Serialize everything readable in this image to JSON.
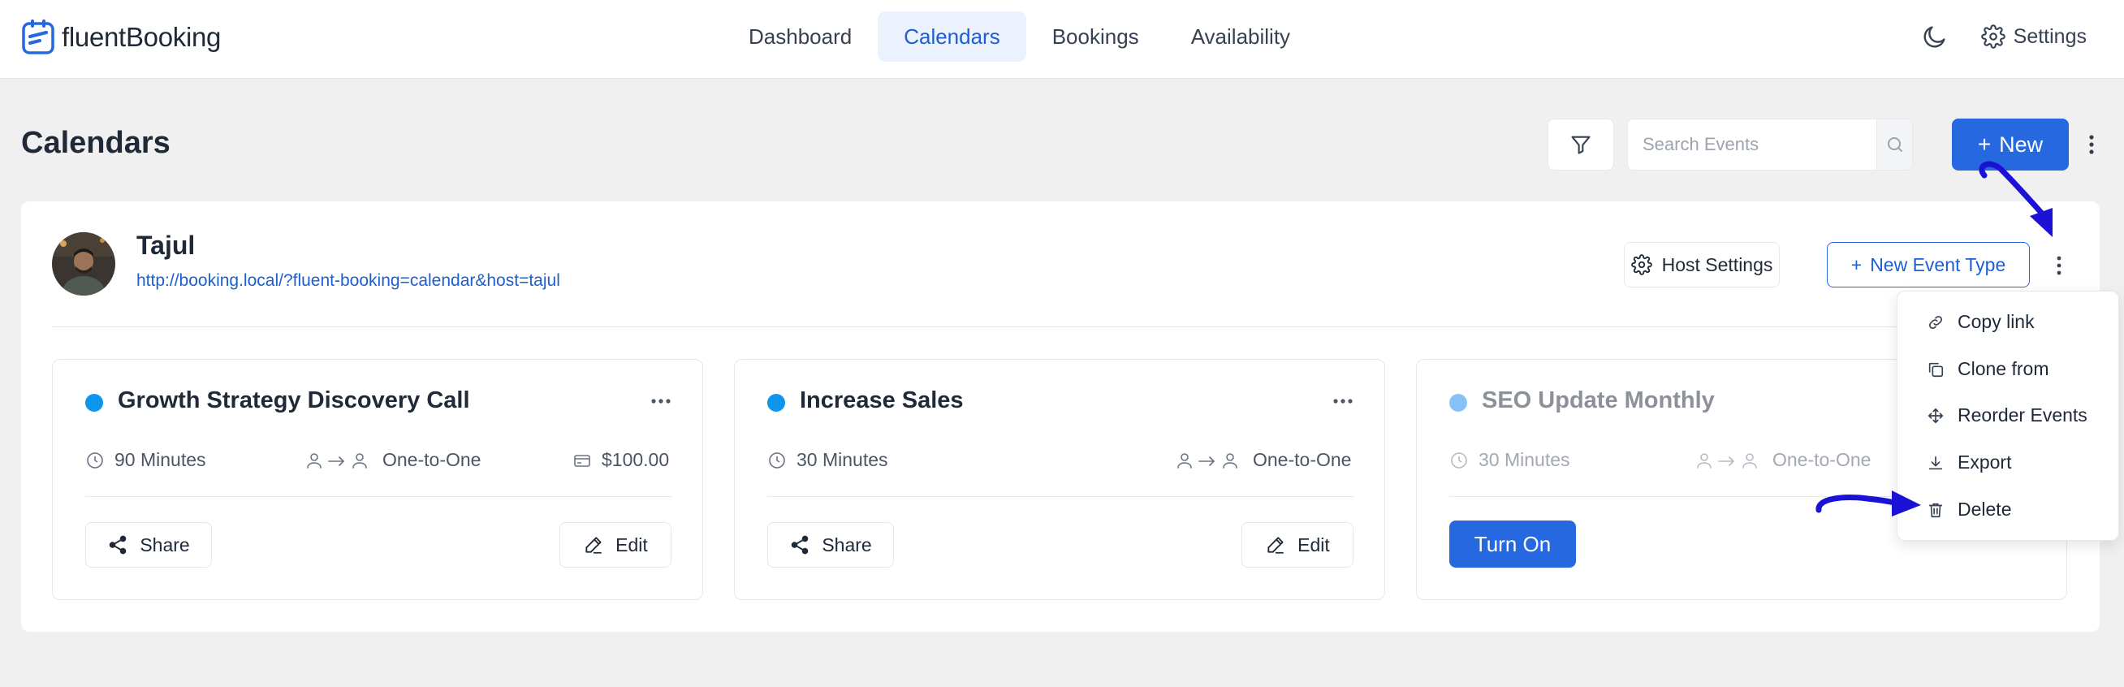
{
  "brand": {
    "logo_word1": "fluent",
    "logo_word2": "Booking",
    "accent": "#2568e0"
  },
  "nav": {
    "items": [
      {
        "label": "Dashboard",
        "active": false
      },
      {
        "label": "Calendars",
        "active": true
      },
      {
        "label": "Bookings",
        "active": false
      },
      {
        "label": "Availability",
        "active": false
      }
    ],
    "settings_label": "Settings",
    "theme_icon": "moon-icon"
  },
  "header": {
    "title": "Calendars",
    "search_placeholder": "Search Events",
    "new_label": "New"
  },
  "host": {
    "name": "Tajul",
    "url": "http://booking.local/?fluent-booking=calendar&host=tajul",
    "host_settings_label": "Host Settings",
    "new_event_type_label": "New Event Type"
  },
  "events": [
    {
      "title": "Growth Strategy Discovery Call",
      "duration": "90 Minutes",
      "type": "One-to-One",
      "price": "$100.00",
      "share_label": "Share",
      "edit_label": "Edit",
      "dot_color": "#0e96ef",
      "enabled": true
    },
    {
      "title": "Increase Sales",
      "duration": "30 Minutes",
      "type": "One-to-One",
      "share_label": "Share",
      "edit_label": "Edit",
      "dot_color": "#0e96ef",
      "enabled": true
    },
    {
      "title": "SEO Update Monthly",
      "duration": "30 Minutes",
      "type": "One-to-One",
      "turn_on_label": "Turn On",
      "dot_color": "#86c2f7",
      "enabled": false
    }
  ],
  "dropdown": {
    "items": [
      {
        "label": "Copy link",
        "icon": "link-icon"
      },
      {
        "label": "Clone from",
        "icon": "clone-icon"
      },
      {
        "label": "Reorder Events",
        "icon": "move-icon"
      },
      {
        "label": "Export",
        "icon": "download-icon"
      },
      {
        "label": "Delete",
        "icon": "trash-icon"
      }
    ]
  },
  "annotation_color": "#1c12d6"
}
